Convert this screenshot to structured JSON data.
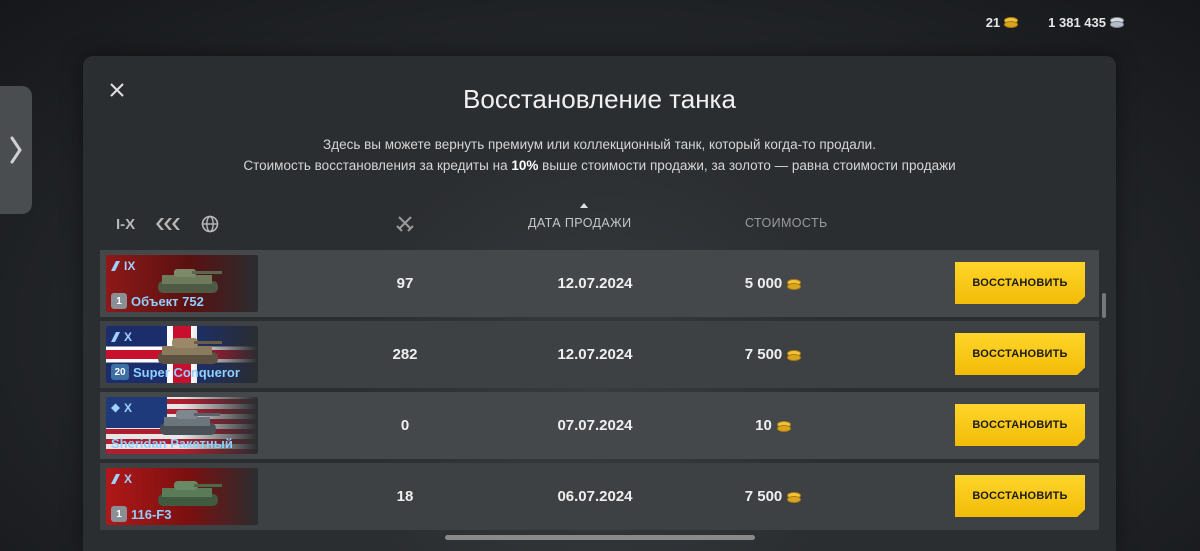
{
  "topbar": {
    "gold": "21",
    "credits": "1 381 435"
  },
  "modal": {
    "title": "Восстановление танка",
    "desc_line1": "Здесь вы можете вернуть премиум или коллекционный танк, который когда-то продали.",
    "desc_line2_a": "Стоимость восстановления за кредиты на ",
    "desc_line2_b": "10%",
    "desc_line2_c": " выше стоимости продажи, за золото — равна стоимости продажи"
  },
  "filters": {
    "tier": "I-X"
  },
  "columns": {
    "date": "ДАТА ПРОДАЖИ",
    "cost": "СТОИМОСТЬ"
  },
  "icons": {
    "close": "close-icon",
    "side": "chevron-right-icon",
    "battles": "crossed-swords-icon",
    "type_filter": "tank-type-icon",
    "nation_filter": "globe-icon",
    "currency": "gold-coin-icon"
  },
  "colors": {
    "accent": "#f2bc08",
    "tank_name": "#8fd0ff",
    "panel": "#2b2e31"
  },
  "rows": [
    {
      "tier": "IX",
      "badge": "1",
      "name": "Объект 752",
      "battles": "97",
      "date": "12.07.2024",
      "cost": "5 000",
      "button": "ВОССТАНОВИТЬ"
    },
    {
      "tier": "X",
      "badge": "20",
      "name": "Super Conqueror",
      "battles": "282",
      "date": "12.07.2024",
      "cost": "7 500",
      "button": "ВОССТАНОВИТЬ"
    },
    {
      "tier": "X",
      "badge": "",
      "name": "Sheridan Ракетный",
      "battles": "0",
      "date": "07.07.2024",
      "cost": "10",
      "button": "ВОССТАНОВИТЬ"
    },
    {
      "tier": "X",
      "badge": "1",
      "name": "116-F3",
      "battles": "18",
      "date": "06.07.2024",
      "cost": "7 500",
      "button": "ВОССТАНОВИТЬ"
    }
  ]
}
